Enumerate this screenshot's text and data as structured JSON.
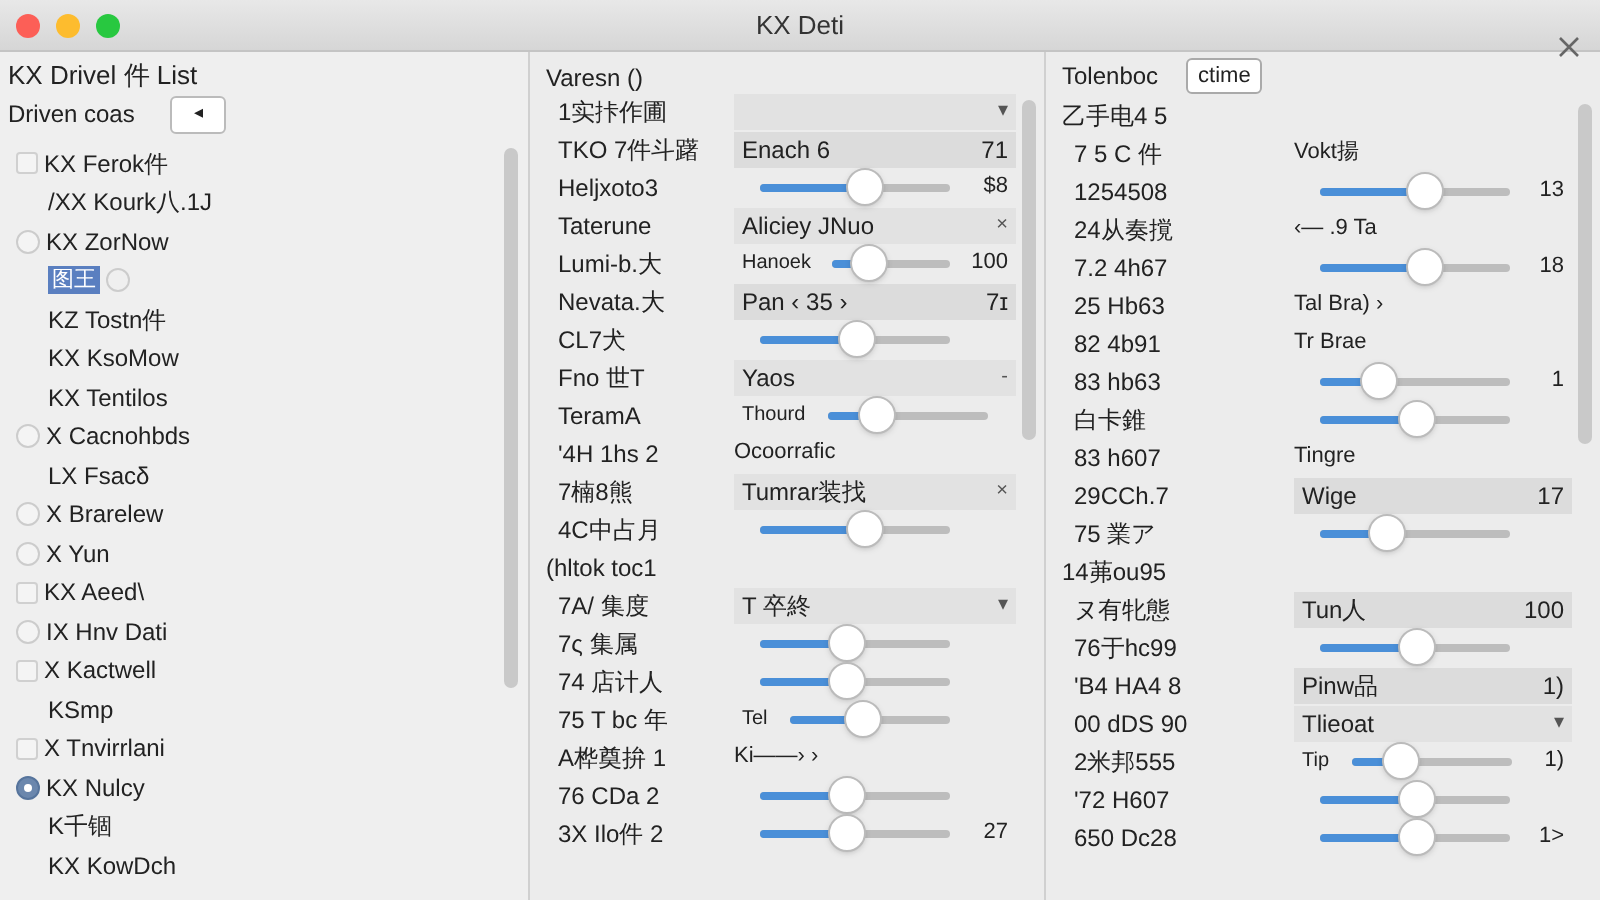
{
  "window": {
    "title": "KX Deti"
  },
  "left": {
    "title": "KX Drivel 件 List",
    "filter_label": "Driven coas",
    "filter_button": "◂",
    "items": [
      {
        "kind": "checkbox",
        "label": "KX Ferok件",
        "checked": false
      },
      {
        "kind": "plain",
        "label": "/XX Kourk八.1J"
      },
      {
        "kind": "radio",
        "label": "KX ZorNow",
        "selected": false
      },
      {
        "kind": "chip",
        "label": "图王"
      },
      {
        "kind": "plain",
        "label": "KZ Tostn件"
      },
      {
        "kind": "plain",
        "label": "KX KsoMow"
      },
      {
        "kind": "plain",
        "label": "KX Tentilos"
      },
      {
        "kind": "radio",
        "label": "X Cacnohbds",
        "selected": false
      },
      {
        "kind": "plain",
        "label": "LX Fsacδ"
      },
      {
        "kind": "radio",
        "label": "X Brarelew",
        "selected": false
      },
      {
        "kind": "radio",
        "label": "X Yun",
        "selected": false
      },
      {
        "kind": "checkbox",
        "label": "KX Aeed\\",
        "checked": false
      },
      {
        "kind": "radio",
        "label": "IX Hnv Dati",
        "selected": false
      },
      {
        "kind": "checkbox",
        "label": "X Kactwell",
        "checked": false
      },
      {
        "kind": "plain",
        "label": "KSmp"
      },
      {
        "kind": "checkbox",
        "label": "X Tnvirrlani",
        "checked": false
      },
      {
        "kind": "radio",
        "label": "KX Nulcy",
        "selected": true
      },
      {
        "kind": "plain",
        "label": "K千锢"
      },
      {
        "kind": "plain",
        "label": "KX KowDch"
      }
    ]
  },
  "middle": {
    "title": "Varesn ()",
    "rows": [
      {
        "kind": "select",
        "label": "1实拤作圃",
        "mark": "▾"
      },
      {
        "kind": "value",
        "label": "TKO 7件斗躇",
        "text": "Enach 6",
        "reading": "71"
      },
      {
        "kind": "slider",
        "label": "Heljxoto3",
        "level": 0.55,
        "reading": "$8"
      },
      {
        "kind": "select",
        "label": "Taterune",
        "text": "Aliciey JNuo",
        "mark": "×"
      },
      {
        "kind": "slider",
        "label": "Lumi-b.大",
        "text": "Hanoek",
        "level": 0.3,
        "reading": "100"
      },
      {
        "kind": "value",
        "label": "Nevata.大",
        "text": "Pan ‹ 35 ›",
        "reading": "7ɪ"
      },
      {
        "kind": "slider",
        "label": "CL7犬",
        "level": 0.5
      },
      {
        "kind": "select",
        "label": "Fno 世T",
        "text": "Yaos",
        "mark": "-"
      },
      {
        "kind": "slider",
        "label": "TeramA",
        "text": "Thourd",
        "level": 0.3
      },
      {
        "kind": "note",
        "label": "'4H 1hs 2",
        "text": "Ocoorrafic"
      },
      {
        "kind": "select",
        "label": "7楠8熊",
        "text": "Tumrar装找",
        "mark": "×"
      },
      {
        "kind": "slider",
        "label": "4C中占月",
        "level": 0.55
      },
      {
        "kind": "section",
        "label": "(hltok toc1"
      },
      {
        "kind": "select",
        "label": "7A/ 集度",
        "text": "T 卒終",
        "mark": "▾"
      },
      {
        "kind": "slider",
        "label": "7ς 集属",
        "level": 0.45
      },
      {
        "kind": "slider",
        "label": "74 店计人",
        "level": 0.45
      },
      {
        "kind": "slider",
        "label": "75 T bc 年",
        "text": "Tel",
        "level": 0.45
      },
      {
        "kind": "note",
        "label": "A桦奠拚 1",
        "text": "Ki——› ›"
      },
      {
        "kind": "slider",
        "label": "76 CDa 2",
        "level": 0.45
      },
      {
        "kind": "slider",
        "label": "3X Ilo件 2",
        "level": 0.45,
        "reading": "27"
      }
    ]
  },
  "right": {
    "title": "Tolenboc",
    "button": "ctime",
    "rows": [
      {
        "kind": "section",
        "label": "乙手电4 5"
      },
      {
        "kind": "note",
        "label": "7 5 C 件",
        "text": "Vokt揚"
      },
      {
        "kind": "slider",
        "label": "1254508",
        "level": 0.55,
        "reading": "13"
      },
      {
        "kind": "note",
        "label": "24从奏撹",
        "text": "‹— .9 Ta"
      },
      {
        "kind": "slider",
        "label": "7.2 4h67",
        "level": 0.55,
        "reading": "18"
      },
      {
        "kind": "note",
        "label": "25 Hb63",
        "text": "Tal Bra) ›"
      },
      {
        "kind": "note",
        "label": "82 4b91",
        "text": "Tr Brae"
      },
      {
        "kind": "slider",
        "label": "83 hb63",
        "level": 0.3,
        "reading": "1"
      },
      {
        "kind": "slider",
        "label": "白卡錐",
        "level": 0.5
      },
      {
        "kind": "note",
        "label": "83 h607",
        "text": "Tingre"
      },
      {
        "kind": "value",
        "label": "29CCh.7",
        "text": "Wige",
        "reading": "17"
      },
      {
        "kind": "slider",
        "label": "75 業ア",
        "level": 0.35
      },
      {
        "kind": "section",
        "label": "14茀ou95"
      },
      {
        "kind": "value",
        "label": "ヌ有牝態",
        "text": "Tun人",
        "reading": "100"
      },
      {
        "kind": "slider",
        "label": "76于hc99",
        "level": 0.5
      },
      {
        "kind": "value",
        "label": "'B4 HA4 8",
        "text": "Pinw品",
        "reading": "1)"
      },
      {
        "kind": "select",
        "label": "00 dDS 90",
        "text": "Tlieoat",
        "mark": "▾"
      },
      {
        "kind": "slider",
        "label": "2米邦555",
        "text": "Tip",
        "level": 0.3,
        "reading": "1)"
      },
      {
        "kind": "slider",
        "label": "'72 H607",
        "level": 0.5
      },
      {
        "kind": "slider",
        "label": "650 Dc28",
        "level": 0.5,
        "reading": "1>"
      }
    ]
  }
}
